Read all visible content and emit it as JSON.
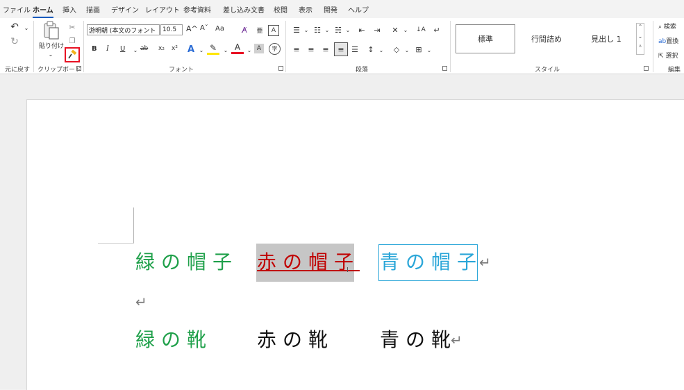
{
  "tabs": [
    "ファイル",
    "ホーム",
    "挿入",
    "描画",
    "デザイン",
    "レイアウト",
    "参考資料",
    "差し込み文書",
    "校閲",
    "表示",
    "開発",
    "ヘルプ"
  ],
  "active_tab": "ホーム",
  "ribbon": {
    "undo": {
      "label": "元に戻す"
    },
    "clipboard": {
      "label": "クリップボード",
      "paste_label": "貼り付け"
    },
    "font": {
      "label": "フォント",
      "font_name": "游明朝 (本文のフォント",
      "font_size": "10.5",
      "grow_label": "A^",
      "shrink_label": "Aˇ",
      "case_label": "Aa",
      "bold": "B",
      "italic": "I",
      "underline": "U",
      "strike": "ab",
      "subscript": "x₂",
      "superscript": "x²"
    },
    "paragraph": {
      "label": "段落"
    },
    "styles": {
      "label": "スタイル",
      "items": [
        "標準",
        "行間詰め",
        "見出し 1"
      ]
    },
    "editing": {
      "label": "編集",
      "find": "検索",
      "replace": "置換",
      "select": "選択"
    }
  },
  "document": {
    "line1": [
      {
        "text": "緑の帽子",
        "color": "#1fa04a"
      },
      {
        "text": "赤の帽子",
        "color": "#c00000"
      },
      {
        "text": "青の帽子",
        "color": "#2aa6d8"
      }
    ],
    "line3": [
      {
        "text": "緑の靴",
        "color": "#1fa04a"
      },
      {
        "text": "赤の靴",
        "color": "#111111"
      },
      {
        "text": "青の靴",
        "color": "#111111"
      }
    ],
    "paragraph_mark": "↵"
  },
  "colors": {
    "accent": "#185abd",
    "highlight_box": "#e81123",
    "selection_bg": "#c6c6c6"
  }
}
